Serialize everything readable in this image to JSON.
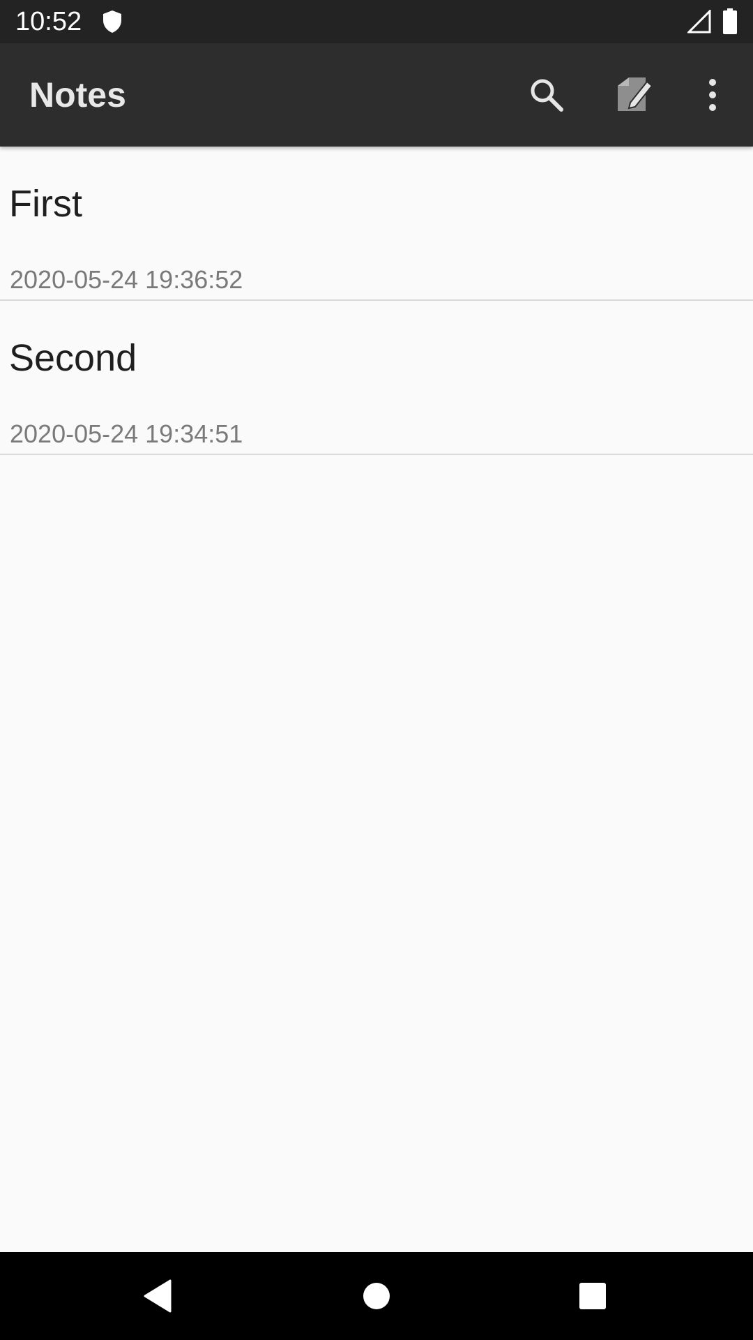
{
  "status_bar": {
    "time": "10:52",
    "icons": [
      "shield-icon",
      "signal-icon",
      "battery-icon"
    ]
  },
  "app_bar": {
    "title": "Notes",
    "actions": [
      "search-icon",
      "new-note-icon",
      "more-vert-icon"
    ]
  },
  "notes": [
    {
      "title": "First",
      "date": "2020-05-24 19:36:52"
    },
    {
      "title": "Second",
      "date": "2020-05-24 19:34:51"
    }
  ],
  "nav_bar": {
    "buttons": [
      "back-icon",
      "home-icon",
      "recents-icon"
    ]
  },
  "colors": {
    "status_bar": "#232323",
    "app_bar": "#2d2d2d",
    "background": "#fafafa",
    "title_text": "#1f1f1f",
    "date_text": "#7a7a7a",
    "divider": "#d9d9d9"
  }
}
